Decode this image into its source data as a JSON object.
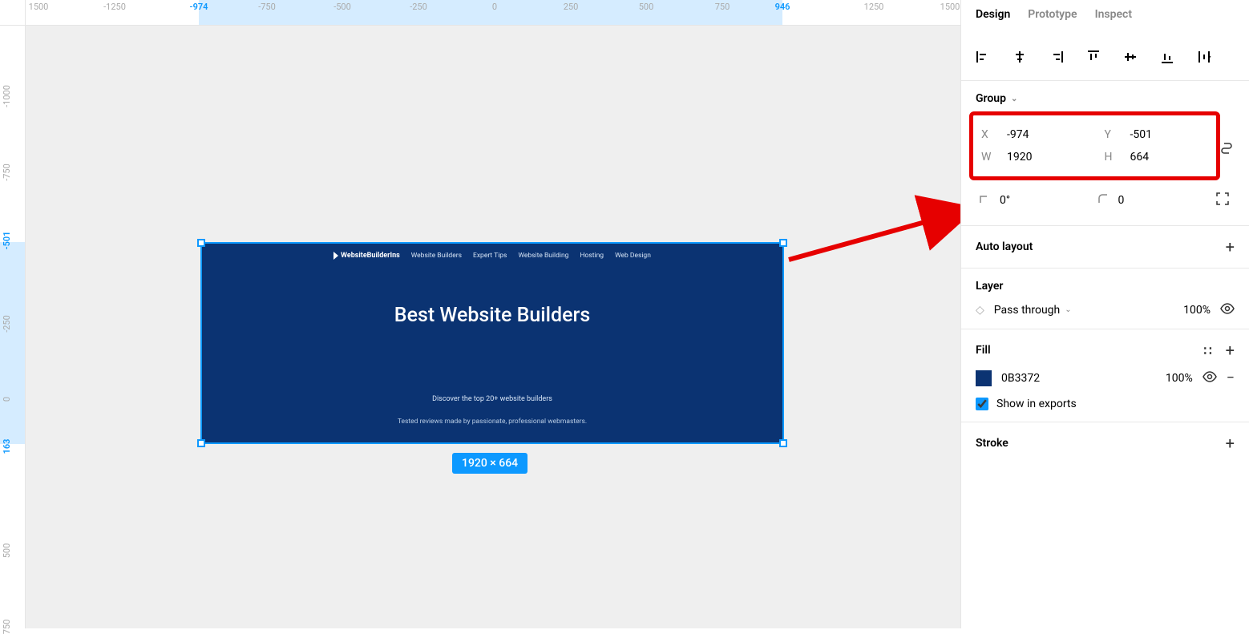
{
  "ruler_top": {
    "selection_start_label": "-974",
    "selection_end_label": "946",
    "ticks": [
      {
        "pos": 16,
        "label": "1500"
      },
      {
        "pos": 111,
        "label": "-1250"
      },
      {
        "pos": 216,
        "label": "-974",
        "bold": true
      },
      {
        "pos": 301,
        "label": "-750"
      },
      {
        "pos": 395,
        "label": "-500"
      },
      {
        "pos": 490,
        "label": "-250"
      },
      {
        "pos": 585,
        "label": "0"
      },
      {
        "pos": 680,
        "label": "250"
      },
      {
        "pos": 774,
        "label": "500"
      },
      {
        "pos": 869,
        "label": "750"
      },
      {
        "pos": 944,
        "label": "946",
        "bold": true
      },
      {
        "pos": 1058,
        "label": "1250"
      },
      {
        "pos": 1153,
        "label": "1500"
      }
    ]
  },
  "ruler_left": {
    "selection_start_label": "-501",
    "selection_end_label": "163",
    "ticks": [
      {
        "pos": 88,
        "label": "-1000"
      },
      {
        "pos": 183,
        "label": "-750"
      },
      {
        "pos": 268,
        "label": "-501",
        "bold": true
      },
      {
        "pos": 372,
        "label": "-250"
      },
      {
        "pos": 466,
        "label": "0"
      },
      {
        "pos": 525,
        "label": "163",
        "bold": true
      },
      {
        "pos": 655,
        "label": "500"
      },
      {
        "pos": 750,
        "label": "750"
      }
    ]
  },
  "canvas": {
    "frame": {
      "logo_text": "WebsiteBuilderIns",
      "nav": [
        "Website Builders",
        "Expert Tips",
        "Website Building",
        "Hosting",
        "Web Design"
      ],
      "hero": "Best Website Builders",
      "sub1": "Discover the top 20+ website builders",
      "sub2": "Tested reviews made by passionate, professional webmasters."
    },
    "size_badge": "1920 × 664"
  },
  "panel": {
    "tabs": [
      "Design",
      "Prototype",
      "Inspect"
    ],
    "active_tab": "Design",
    "group_label": "Group",
    "position": {
      "x": "-974",
      "y": "-501",
      "w": "1920",
      "h": "664"
    },
    "rotation": "0°",
    "corner_radius": "0",
    "auto_layout_label": "Auto layout",
    "layer": {
      "title": "Layer",
      "mode": "Pass through",
      "opacity": "100%"
    },
    "fill": {
      "title": "Fill",
      "hex": "0B3372",
      "opacity": "100%",
      "show_in_exports": "Show in exports"
    },
    "stroke_label": "Stroke"
  }
}
